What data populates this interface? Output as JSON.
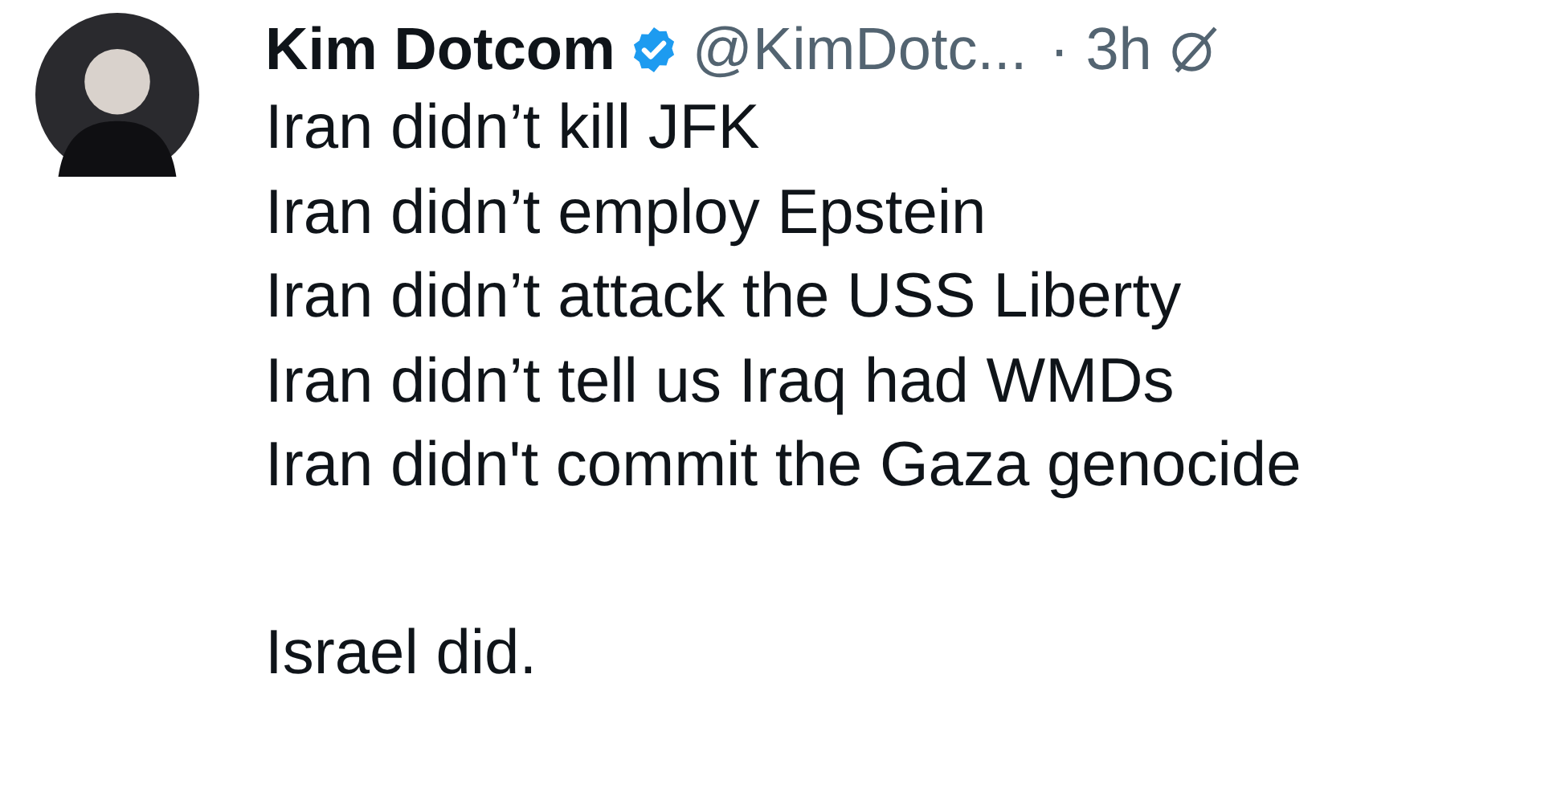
{
  "post": {
    "author": {
      "name": "Kim Dotcom",
      "verified": true,
      "handle": "@KimDotc...",
      "time": "· 3h"
    },
    "lines": [
      "Iran didn’t kill JFK",
      "Iran didn’t employ Epstein",
      "Iran didn’t attack the USS Liberty",
      "Iran didn’t tell us Iraq had WMDs",
      "Iran didn't commit the Gaza genocide"
    ],
    "closing": "Israel did."
  }
}
